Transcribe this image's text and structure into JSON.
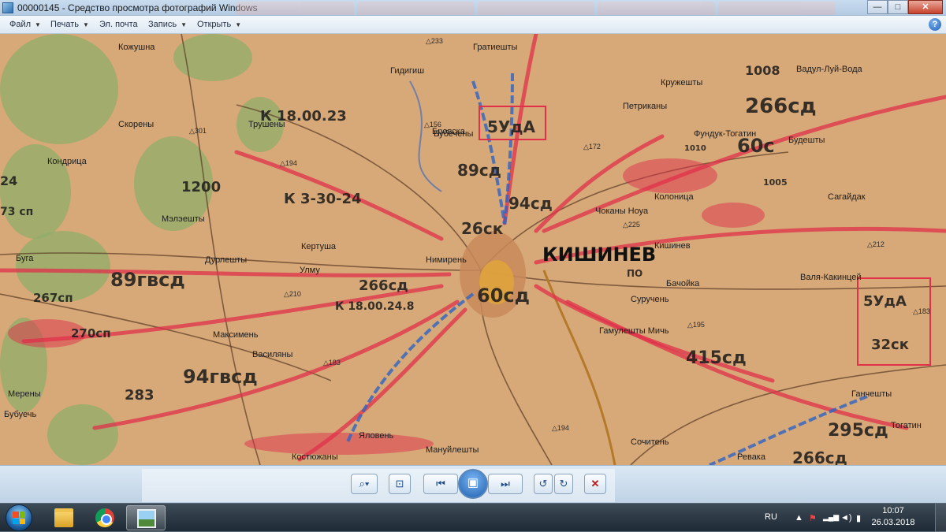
{
  "window": {
    "title": "00000145 - Средство просмотра фотографий Windows",
    "minimize_label": "—",
    "maximize_label": "□",
    "close_label": "✕"
  },
  "menu": {
    "file": "Файл",
    "print": "Печать",
    "email": "Эл. почта",
    "record": "Запись",
    "open": "Открыть",
    "help": "?"
  },
  "map": {
    "places": [
      "Кожушна",
      "Гидигиш",
      "Гратиешты",
      "Кружешты",
      "Вадул-Луй-Вода",
      "Скорены",
      "Трушены",
      "Бубечены",
      "Будешты",
      "Колоница",
      "Сагайдак",
      "Кондрица",
      "Мэлэешты",
      "Кертуша",
      "Чоканы Ноуа",
      "Кишинев",
      "Буга",
      "Улму",
      "Дурлешты",
      "Нимирень",
      "Бачойка",
      "Валя-Какинцей",
      "Максимень",
      "Суручень",
      "Гамулешты Мичь",
      "Бубуечь",
      "Василяны",
      "Ганчешты",
      "Мерены",
      "Мануйлешты",
      "Яловень",
      "Костюжаны",
      "Сочитень",
      "Ревака",
      "Бровска",
      "Петриканы",
      "Фундук-Тогатин",
      "Тогатин"
    ],
    "heights": [
      "233",
      "156",
      "172",
      "301",
      "194",
      "210",
      "183",
      "195",
      "194",
      "225",
      "212",
      "183"
    ],
    "unit_labels": [
      "5УдА",
      "89сд",
      "94сд",
      "26ск",
      "266сд",
      "60сд",
      "1008",
      "266сд",
      "60с",
      "1010",
      "1005",
      "89гвсд",
      "267сп",
      "270сп",
      "94гвсд",
      "283",
      "5УдА",
      "32ск",
      "415сд",
      "295сд",
      "266сд",
      "К 18.00.24.8",
      "К 18.00.23",
      "К 3-30-24",
      "1200",
      "24",
      "73 сп",
      "ПО"
    ],
    "city_label": "КИШИНЕВ"
  },
  "controls": {
    "zoom": "⌕▾",
    "actual_size": "⊡",
    "previous": "⏮",
    "slideshow": "▣",
    "next": "⏭",
    "rotate_ccw": "↺",
    "rotate_cw": "↻",
    "delete": "✕"
  },
  "taskbar": {
    "language": "RU",
    "time": "10:07",
    "date": "26.03.2018",
    "tray_up": "▲",
    "tray_flag": "⚑",
    "tray_signal": "▂▄▆",
    "tray_volume": "◄)",
    "tray_battery": "▮"
  },
  "colors": {
    "titlebar": "#c9dcef",
    "map_paper": "#d7a878",
    "forest": "#8fae6a",
    "red_arrows": "#e0304a",
    "blue_arrows": "#2e64c4"
  }
}
